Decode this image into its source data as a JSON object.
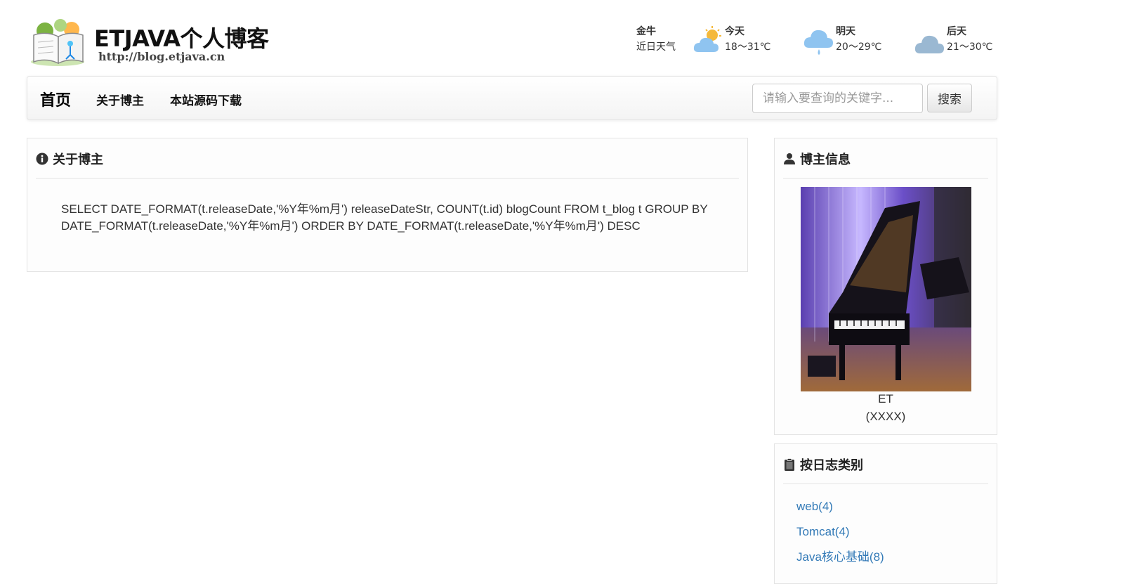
{
  "site": {
    "title": "ETJAVA个人博客",
    "url": "http://blog.etjava.cn"
  },
  "weather": {
    "location": "金牛",
    "subtitle": "近日天气",
    "days": [
      {
        "day": "今天",
        "temp": "18～31℃",
        "icon": "partly-sunny-icon"
      },
      {
        "day": "明天",
        "temp": "20～29℃",
        "icon": "rain-icon"
      },
      {
        "day": "后天",
        "temp": "21～30℃",
        "icon": "cloudy-icon"
      }
    ]
  },
  "nav": {
    "home": "首页",
    "about": "关于博主",
    "download": "本站源码下载",
    "search_placeholder": "请输入要查询的关键字...",
    "search_button": "搜索"
  },
  "main": {
    "heading": "关于博主",
    "body": "SELECT DATE_FORMAT(t.releaseDate,'%Y年%m月') releaseDateStr, COUNT(t.id) blogCount FROM t_blog t GROUP BY DATE_FORMAT(t.releaseDate,'%Y年%m月') ORDER BY DATE_FORMAT(t.releaseDate,'%Y年%m月') DESC"
  },
  "blogger": {
    "heading": "博主信息",
    "name": "ET",
    "sign": "(XXXX)"
  },
  "categories": {
    "heading": "按日志类别",
    "items": [
      "web(4)",
      "Tomcat(4)",
      "Java核心基础(8)"
    ]
  },
  "colors": {
    "link": "#337ab7",
    "cloud_light": "#8fc4f0",
    "cloud_gray": "#9ab8d2",
    "sun": "#f5b93a"
  }
}
